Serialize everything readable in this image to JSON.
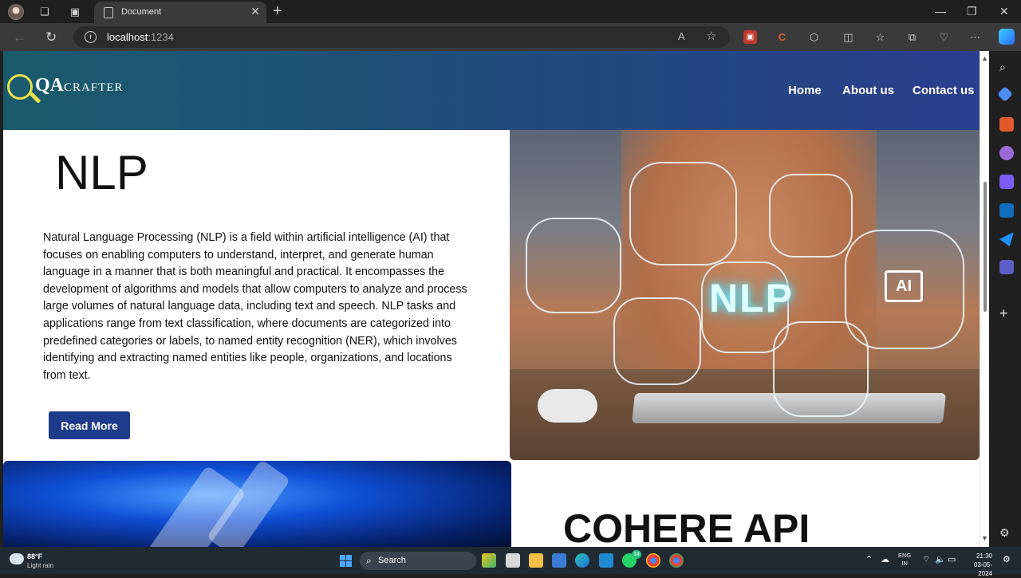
{
  "browser": {
    "tab_title": "Document",
    "url_host": "localhost",
    "url_port": ":1234"
  },
  "site": {
    "logo_qa": "QA",
    "logo_crafter": "CRAFTER",
    "nav": [
      {
        "label": "Home"
      },
      {
        "label": "About us"
      },
      {
        "label": "Contact us"
      }
    ]
  },
  "nlp_section": {
    "title": "NLP",
    "body": "Natural Language Processing (NLP) is a field within artificial intelligence (AI) that focuses on enabling computers to understand, interpret, and generate human language in a manner that is both meaningful and practical. It encompasses the development of algorithms and models that allow computers to analyze and process large volumes of natural language data, including text and speech. NLP tasks and applications range from text classification, where documents are categorized into predefined categories or labels, to named entity recognition (NER), which involves identifying and extracting named entities like people, organizations, and locations from text.",
    "button_label": "Read More",
    "image_overlay_text": "NLP",
    "image_chip_text": "AI"
  },
  "cohere_section": {
    "title": "COHERE API"
  },
  "taskbar": {
    "weather_temp": "88°F",
    "weather_desc": "Light rain",
    "search_label": "Search",
    "whatsapp_badge": "14",
    "lang_line1": "ENG",
    "lang_line2": "IN",
    "time": "21:30",
    "date": "03-05-2024"
  },
  "colors": {
    "header_gradient_start": "#1a5b6c",
    "header_gradient_end": "#2b3f8e",
    "button_bg": "#1e3a8a",
    "logo_accent": "#e9e14c"
  }
}
